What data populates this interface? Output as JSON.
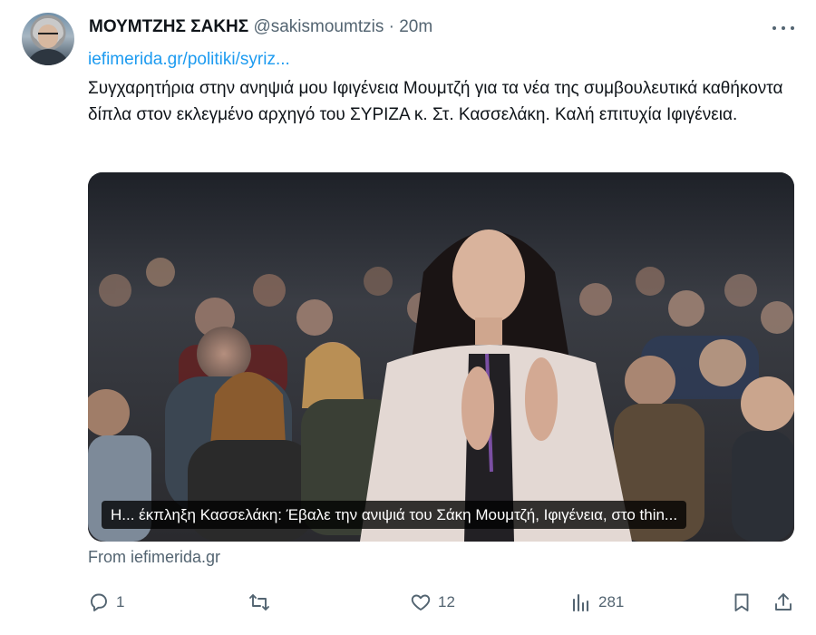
{
  "author": {
    "name": "ΜΟΥΜΤΖΗΣ ΣΑΚΗΣ",
    "handle": "@sakismoumtzis",
    "separator": "·",
    "time": "20m"
  },
  "tweet": {
    "link_text": "iefimerida.gr/politiki/syriz...",
    "text": "Συγχαρητήρια στην ανηψιά μου Ιφιγένεια Μουμτζή για τα νέα της συμβουλευτικά καθήκοντα δίπλα στον εκλεγμένο αρχηγό του ΣΥΡΙΖΑ κ. Στ. Κασσελάκη. Καλή επιτυχία Ιφιγένεια."
  },
  "card": {
    "caption": "Η... έκπληξη Κασσελάκη: Έβαλε την ανιψιά του Σάκη Μουμτζή, Ιφιγένεια, στο thin...",
    "source": "From iefimerida.gr"
  },
  "actions": {
    "reply_count": "1",
    "retweet_count": "",
    "like_count": "12",
    "views_count": "281"
  },
  "icons": [
    "avatar",
    "more-icon",
    "reply-icon",
    "retweet-icon",
    "like-icon",
    "views-icon",
    "bookmark-icon",
    "share-icon"
  ],
  "colors": {
    "link": "#1d9bf0",
    "secondary_text": "#536471",
    "primary_text": "#0f1419"
  }
}
